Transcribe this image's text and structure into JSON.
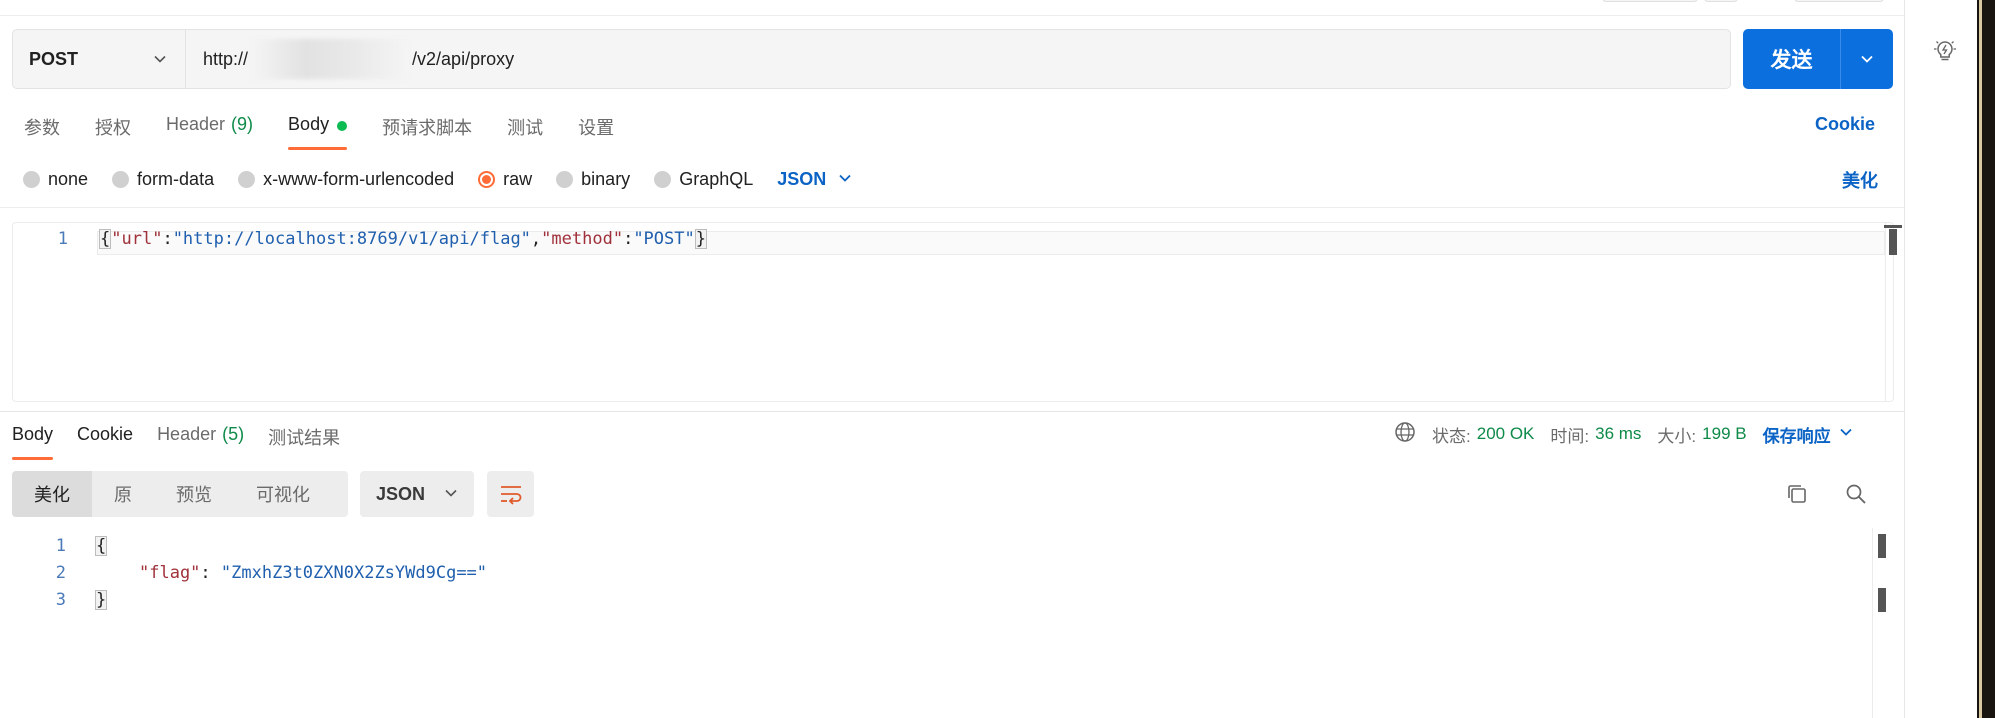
{
  "request": {
    "method": "POST",
    "url_prefix": "http://",
    "url_suffix": "/v2/api/proxy",
    "send_label": "发送"
  },
  "request_tabs": [
    {
      "label": "参数"
    },
    {
      "label": "授权"
    },
    {
      "label": "Header",
      "count": "(9)"
    },
    {
      "label": "Body",
      "active": true
    },
    {
      "label": "预请求脚本"
    },
    {
      "label": "测试"
    },
    {
      "label": "设置"
    }
  ],
  "cookie_link": "Cookie",
  "body_types": [
    {
      "label": "none",
      "selected": false
    },
    {
      "label": "form-data",
      "selected": false
    },
    {
      "label": "x-www-form-urlencoded",
      "selected": false
    },
    {
      "label": "raw",
      "selected": true
    },
    {
      "label": "binary",
      "selected": false
    },
    {
      "label": "GraphQL",
      "selected": false
    }
  ],
  "body_format": "JSON",
  "beautify_label": "美化",
  "request_body": {
    "line_numbers": [
      "1"
    ],
    "open": "{",
    "k1": "\"url\"",
    "colon1": ":",
    "v1": "\"http://localhost:8769/v1/api/flag\"",
    "comma": ",",
    "k2": "\"method\"",
    "colon2": ":",
    "v2": "\"POST\"",
    "close": "}"
  },
  "response_tabs": [
    {
      "label": "Body",
      "active": true
    },
    {
      "label": "Cookie"
    },
    {
      "label": "Header",
      "count": "(5)"
    },
    {
      "label": "测试结果"
    }
  ],
  "response_meta": {
    "status_label": "状态:",
    "status_value": "200 OK",
    "time_label": "时间:",
    "time_value": "36 ms",
    "size_label": "大小:",
    "size_value": "199 B",
    "save_label": "保存响应"
  },
  "view_modes": [
    "美化",
    "原",
    "预览",
    "可视化"
  ],
  "response_format": "JSON",
  "response_body": {
    "line_numbers": [
      "1",
      "2",
      "3"
    ],
    "open": "{",
    "key": "\"flag\"",
    "colon": ":",
    "value": "\"ZmxhZ3t0ZXN0X2ZsYWd9Cg==\"",
    "close": "}"
  },
  "colors": {
    "accent": "#ff6c37",
    "primary": "#0b6fde",
    "link": "#0b63c5",
    "success": "#0e8a49"
  },
  "icons": [
    "chevron-down-icon",
    "globe-icon",
    "wrap-lines-icon",
    "copy-icon",
    "search-icon",
    "lightbulb-icon"
  ]
}
